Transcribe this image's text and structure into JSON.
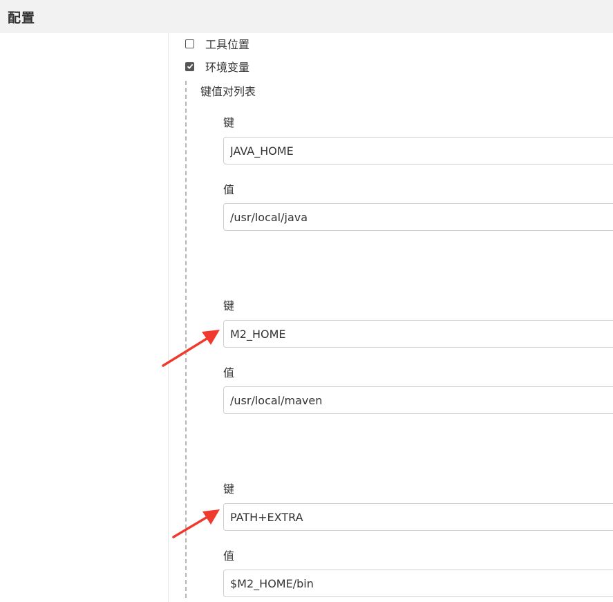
{
  "header": {
    "title": "配置"
  },
  "options": {
    "tool_location": {
      "label": "工具位置",
      "checked": false
    },
    "env_vars": {
      "label": "环境变量",
      "checked": true
    }
  },
  "env_section": {
    "title": "键值对列表",
    "entries": [
      {
        "key_label": "键",
        "key_value": "JAVA_HOME",
        "value_label": "值",
        "value_value": "/usr/local/java"
      },
      {
        "key_label": "键",
        "key_value": "M2_HOME",
        "value_label": "值",
        "value_value": "/usr/local/maven"
      },
      {
        "key_label": "键",
        "key_value": "PATH+EXTRA",
        "value_label": "值",
        "value_value": "$M2_HOME/bin"
      }
    ]
  },
  "colors": {
    "annotation_arrow": "#f03a2e"
  }
}
